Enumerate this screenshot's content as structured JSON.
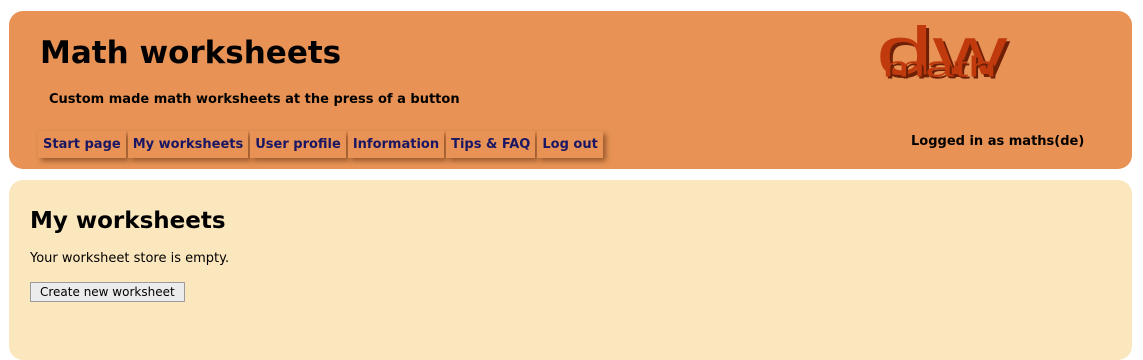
{
  "header": {
    "title": "Math worksheets",
    "tagline": "Custom made math worksheets at the press of a button",
    "logo": {
      "top_text": "dw",
      "bottom_text": "math",
      "color": "#c03a0e"
    },
    "background_color": "#e89355",
    "login_status": "Logged in as maths(de)"
  },
  "nav": {
    "items": [
      {
        "label": "Start page"
      },
      {
        "label": "My worksheets"
      },
      {
        "label": "User profile"
      },
      {
        "label": "Information"
      },
      {
        "label": "Tips & FAQ"
      },
      {
        "label": "Log out"
      }
    ],
    "link_color": "#1a1663"
  },
  "main": {
    "heading": "My worksheets",
    "empty_message": "Your worksheet store is empty.",
    "create_button_label": "Create new worksheet",
    "background_color": "#fae7bd"
  }
}
